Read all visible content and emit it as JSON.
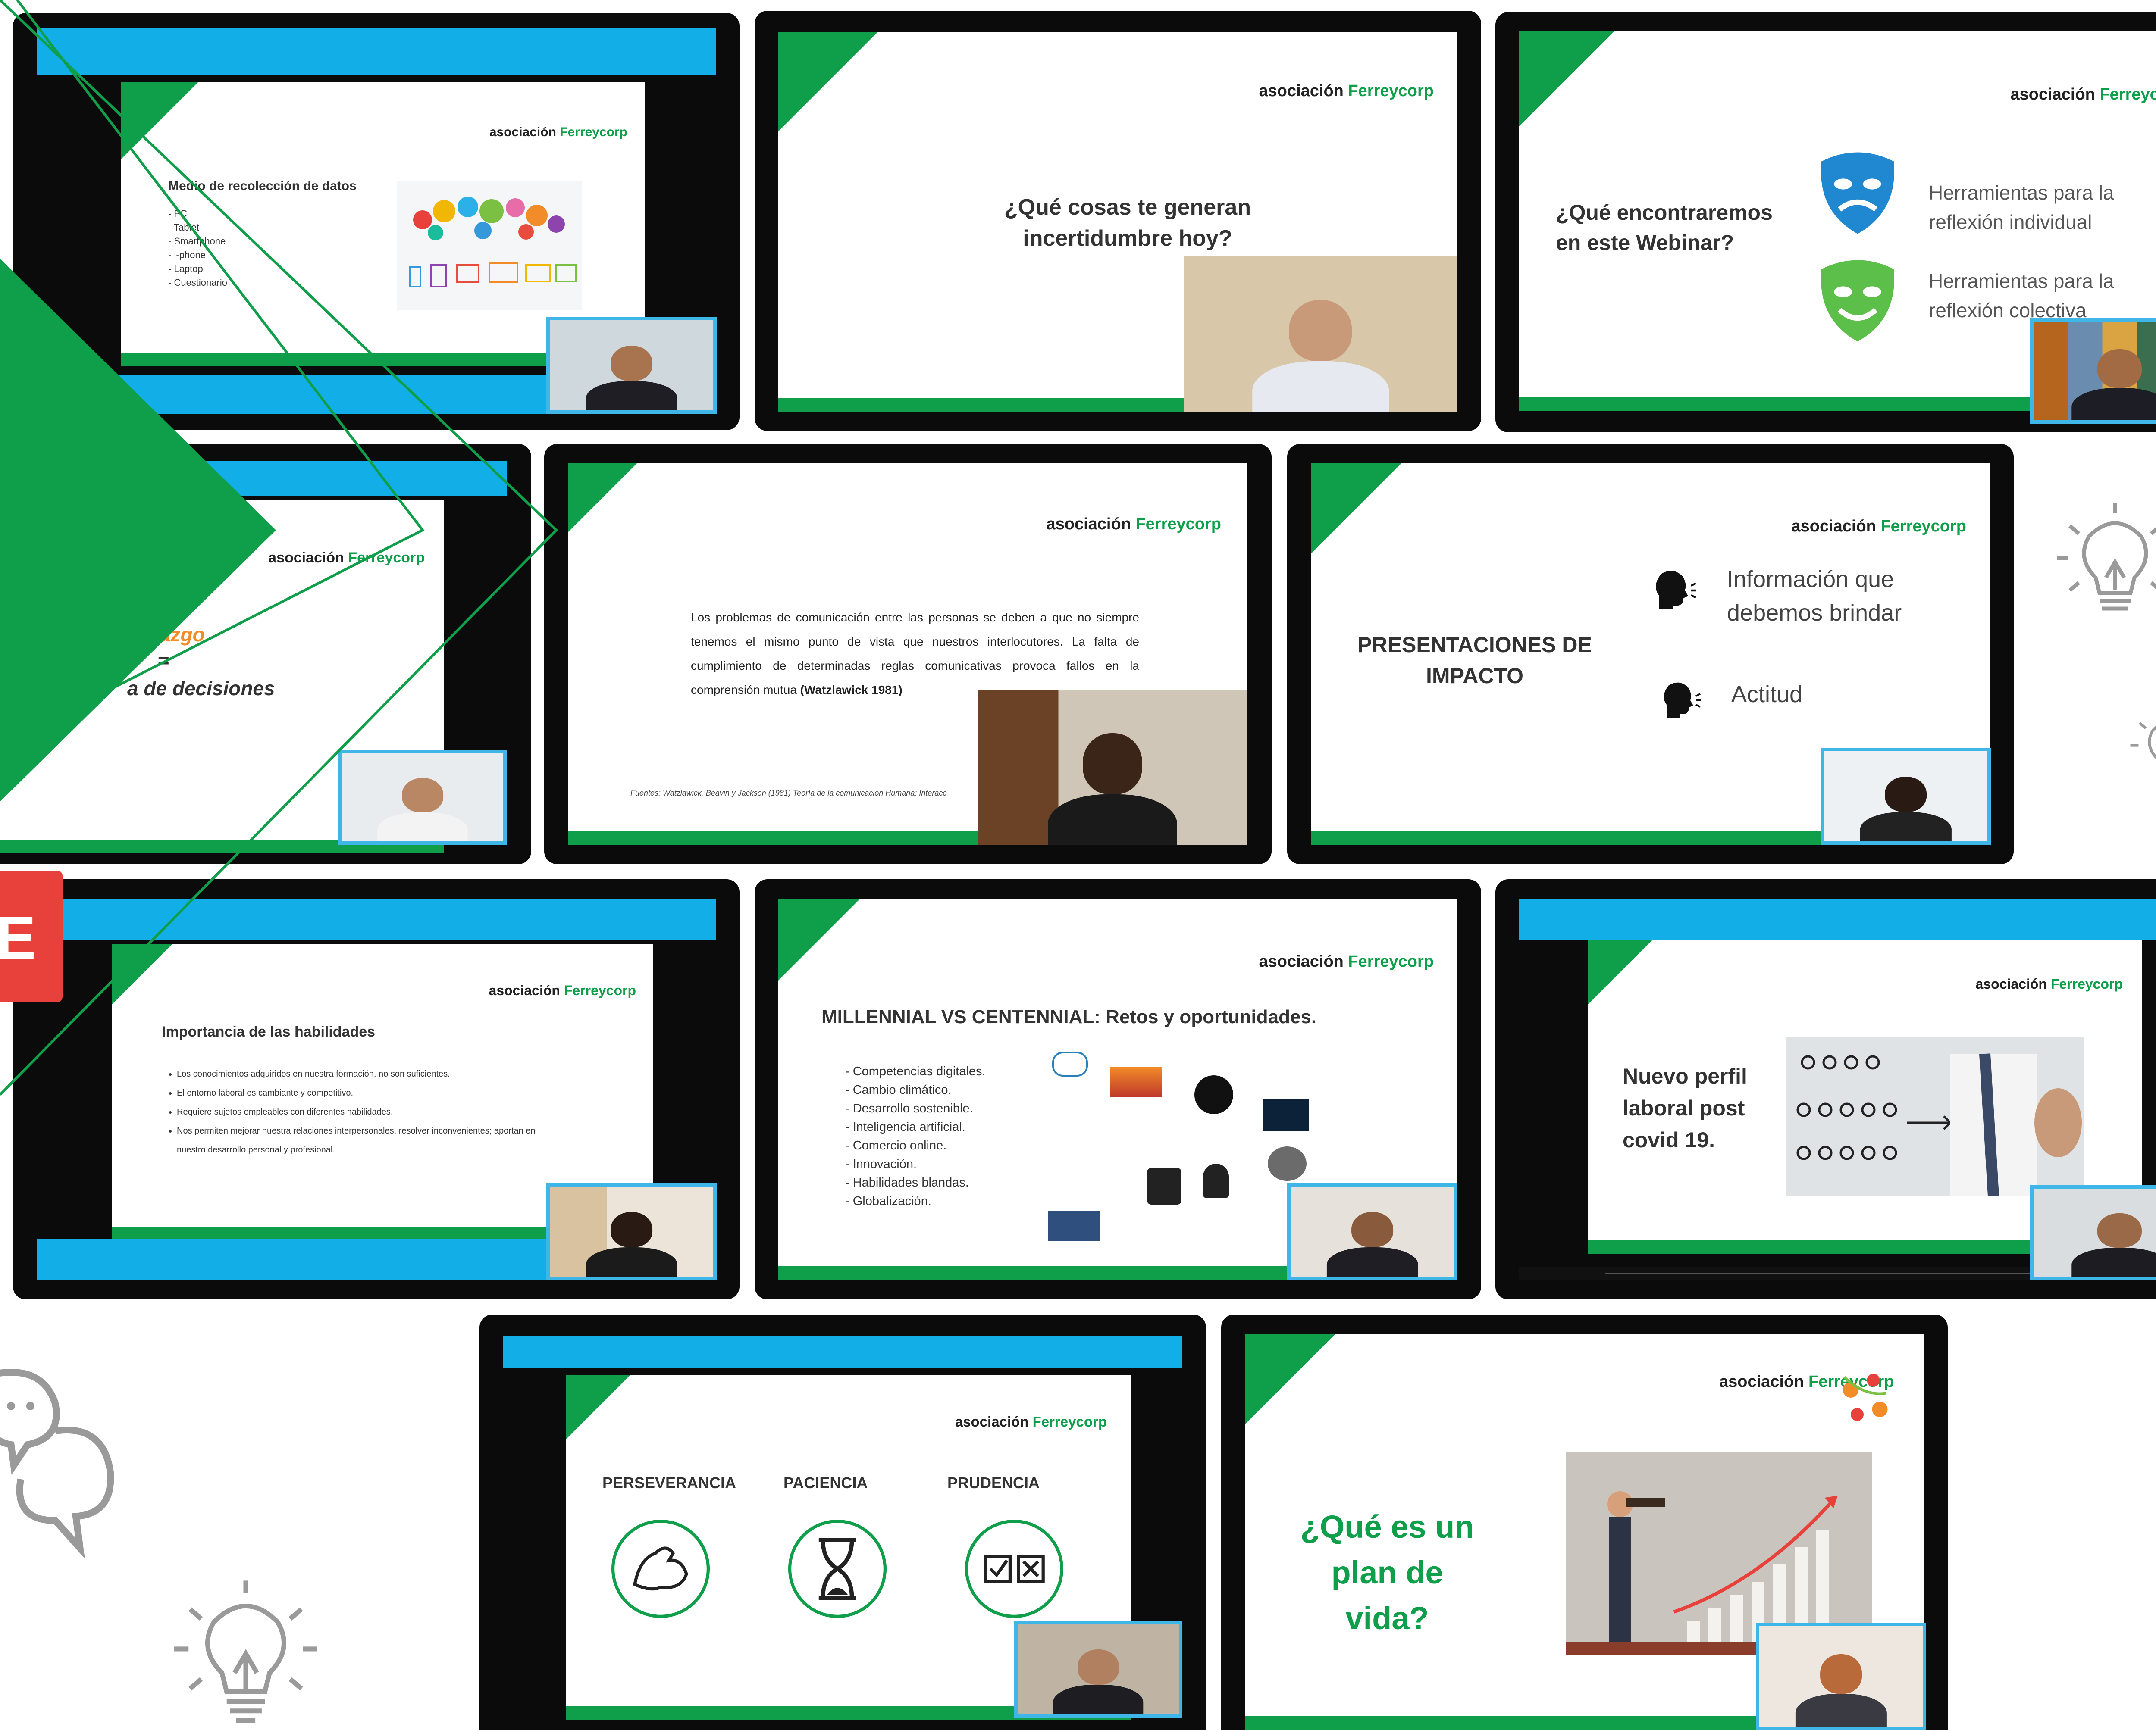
{
  "brand": {
    "logo_part1": "asociación",
    "logo_part2": "Ferreycorp",
    "colors": {
      "green": "#0f9f4a",
      "cyan": "#12aee8",
      "frame": "#0b0b0b",
      "accent_red": "#e8403a",
      "orange": "#f28c28"
    }
  },
  "slides": {
    "s1": {
      "title": "Medio de recolección de datos",
      "items": [
        "PC",
        "Tablet",
        "Smartphone",
        "i-phone",
        "Laptop",
        "Cuestionario"
      ],
      "icon": "devices-cloud-icon"
    },
    "s2": {
      "question": "¿Qué cosas te generan incertidumbre hoy?"
    },
    "s3": {
      "question": "¿Qué encontraremos en este Webinar?",
      "item1": "Herramientas para la reflexión individual",
      "item2": "Herramientas para la reflexión colectiva",
      "icon1": "theater-mask-blue-icon",
      "icon2": "theater-mask-green-icon"
    },
    "s4": {
      "line1": "azgo",
      "line2": "=",
      "line3": "a de decisiones"
    },
    "s5": {
      "body_pre": "Los problemas de comunicación entre las personas se deben a que no siempre tenemos el mismo punto de vista que nuestros interlocutores. La falta de cumplimiento de determinadas reglas comunicativas provoca fallos en la comprensión mutua",
      "body_cite": "(Watzlawick 1981)",
      "footnote": "Fuentes: Watzlawick, Beavin y Jackson (1981) Teoría de la comunicación Humana: Interacc"
    },
    "s6": {
      "title": "PRESENTACIONES DE IMPACTO",
      "item1": "Información que debemos brindar",
      "item2": "Actitud",
      "icon": "speaking-head-icon"
    },
    "s7": {
      "title": "Importancia de las habilidades",
      "bullets": [
        "Los conocimientos adquiridos en nuestra formación, no son suficientes.",
        "El entorno laboral es cambiante y competitivo.",
        "Requiere sujetos empleables con diferentes habilidades.",
        "Nos permiten mejorar nuestra relaciones interpersonales, resolver inconvenientes; aportan en nuestro desarrollo personal y profesional."
      ]
    },
    "s8": {
      "title": "MILLENNIAL VS CENTENNIAL: Retos y oportunidades.",
      "items": [
        "Competencias digitales.",
        "Cambio climático.",
        "Desarrollo sostenible.",
        "Inteligencia artificial.",
        "Comercio online.",
        "Innovación.",
        "Habilidades blandas.",
        "Globalización."
      ]
    },
    "s9": {
      "title": "Nuevo perfil laboral post covid 19.",
      "image": "network-people-drawing-icon"
    },
    "s10": {
      "labels": [
        "PERSEVERANCIA",
        "PACIENCIA",
        "PRUDENCIA"
      ],
      "icons": [
        "flexed-arm-icon",
        "hourglass-icon",
        "checkbox-icon"
      ]
    },
    "s11": {
      "question": "¿Qué es un plan de vida?",
      "image": "growth-chart-telescope-icon"
    }
  },
  "decor": {
    "side_tab_letter": "E"
  }
}
